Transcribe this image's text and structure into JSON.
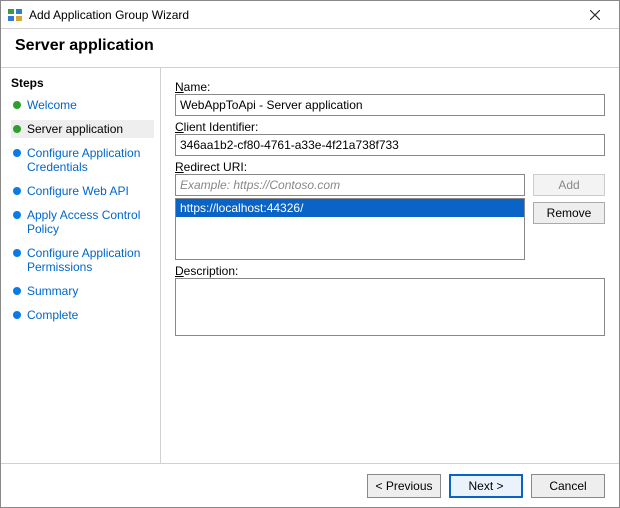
{
  "window": {
    "title": "Add Application Group Wizard"
  },
  "header": {
    "title": "Server application"
  },
  "steps": {
    "heading": "Steps",
    "items": [
      {
        "label": "Welcome",
        "state": "done"
      },
      {
        "label": "Server application",
        "state": "current"
      },
      {
        "label": "Configure Application Credentials",
        "state": "pending"
      },
      {
        "label": "Configure Web API",
        "state": "pending"
      },
      {
        "label": "Apply Access Control Policy",
        "state": "pending"
      },
      {
        "label": "Configure Application Permissions",
        "state": "pending"
      },
      {
        "label": "Summary",
        "state": "pending"
      },
      {
        "label": "Complete",
        "state": "pending"
      }
    ]
  },
  "form": {
    "name_label": "Name:",
    "name_value": "WebAppToApi - Server application",
    "client_id_label": "Client Identifier:",
    "client_id_value": "346aa1b2-cf80-4761-a33e-4f21a738f733",
    "redirect_label": "Redirect URI:",
    "redirect_placeholder": "Example: https://Contoso.com",
    "redirect_input_value": "",
    "redirect_items": [
      "https://localhost:44326/"
    ],
    "add_label": "Add",
    "remove_label": "Remove",
    "description_label": "Description:",
    "description_value": ""
  },
  "footer": {
    "previous": "< Previous",
    "next": "Next >",
    "cancel": "Cancel"
  }
}
